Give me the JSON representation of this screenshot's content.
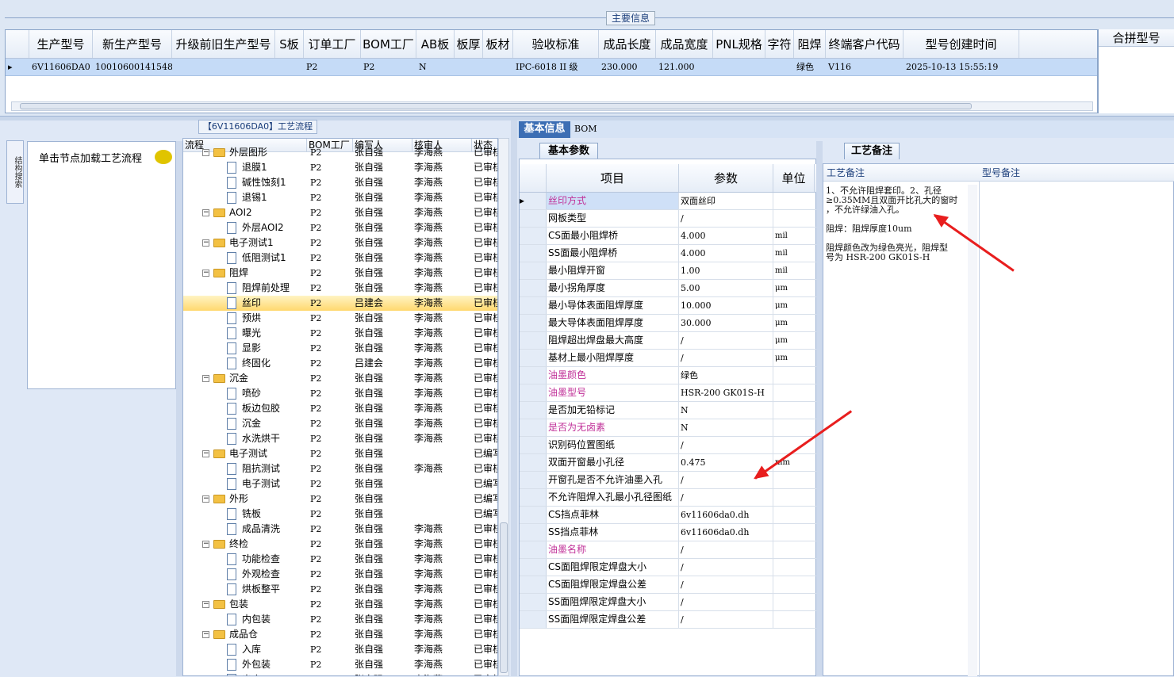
{
  "top": {
    "section_title": "主要信息",
    "columns": [
      "",
      "生产型号",
      "新生产型号",
      "升级前旧生产型号",
      "S板",
      "订单工厂",
      "BOM工厂",
      "AB板",
      "板厚",
      "板材",
      "验收标准",
      "成品长度",
      "成品宽度",
      "PNL规格",
      "字符",
      "阻焊",
      "终端客户代码",
      "型号创建时间"
    ],
    "row": [
      "▸",
      "6V11606DA0",
      "10010600141548",
      "",
      "",
      "P2",
      "P2",
      "N",
      "",
      "",
      "IPC-6018 II 级",
      "230.000",
      "121.000",
      "",
      "",
      "绿色",
      "V116",
      "2025-10-13 15:55:19"
    ],
    "merge_header": "合拼型号"
  },
  "left": {
    "side_tab": "结构搜索",
    "prompt": "单击节点加载工艺流程"
  },
  "tree": {
    "title": "【6V11606DA0】工艺流程",
    "columns": [
      "流程",
      "BOM工厂",
      "编写人",
      "核审人",
      "状态"
    ],
    "rows": [
      {
        "level": 1,
        "type": "folder",
        "name": "外层图形",
        "bom": "P2",
        "writer": "张自强",
        "checker": "李海燕",
        "status": "已审核"
      },
      {
        "level": 2,
        "type": "doc",
        "name": "退膜1",
        "bom": "P2",
        "writer": "张自强",
        "checker": "李海燕",
        "status": "已审核"
      },
      {
        "level": 2,
        "type": "doc",
        "name": "碱性蚀刻1",
        "bom": "P2",
        "writer": "张自强",
        "checker": "李海燕",
        "status": "已审核"
      },
      {
        "level": 2,
        "type": "doc",
        "name": "退锡1",
        "bom": "P2",
        "writer": "张自强",
        "checker": "李海燕",
        "status": "已审核"
      },
      {
        "level": 1,
        "type": "folder",
        "name": "AOI2",
        "bom": "P2",
        "writer": "张自强",
        "checker": "李海燕",
        "status": "已审核"
      },
      {
        "level": 2,
        "type": "doc",
        "name": "外层AOI2",
        "bom": "P2",
        "writer": "张自强",
        "checker": "李海燕",
        "status": "已审核"
      },
      {
        "level": 1,
        "type": "folder",
        "name": "电子测试1",
        "bom": "P2",
        "writer": "张自强",
        "checker": "李海燕",
        "status": "已审核"
      },
      {
        "level": 2,
        "type": "doc",
        "name": "低阻测试1",
        "bom": "P2",
        "writer": "张自强",
        "checker": "李海燕",
        "status": "已审核"
      },
      {
        "level": 1,
        "type": "folder",
        "name": "阻焊",
        "bom": "P2",
        "writer": "张自强",
        "checker": "李海燕",
        "status": "已审核"
      },
      {
        "level": 2,
        "type": "doc",
        "name": "阻焊前处理",
        "bom": "P2",
        "writer": "张自强",
        "checker": "李海燕",
        "status": "已审核"
      },
      {
        "level": 2,
        "type": "doc",
        "name": "丝印",
        "bom": "P2",
        "writer": "吕建会",
        "checker": "李海燕",
        "status": "已审核",
        "selected": true
      },
      {
        "level": 2,
        "type": "doc",
        "name": "预烘",
        "bom": "P2",
        "writer": "张自强",
        "checker": "李海燕",
        "status": "已审核"
      },
      {
        "level": 2,
        "type": "doc",
        "name": "曝光",
        "bom": "P2",
        "writer": "张自强",
        "checker": "李海燕",
        "status": "已审核"
      },
      {
        "level": 2,
        "type": "doc",
        "name": "显影",
        "bom": "P2",
        "writer": "张自强",
        "checker": "李海燕",
        "status": "已审核"
      },
      {
        "level": 2,
        "type": "doc",
        "name": "终固化",
        "bom": "P2",
        "writer": "吕建会",
        "checker": "李海燕",
        "status": "已审核"
      },
      {
        "level": 1,
        "type": "folder",
        "name": "沉金",
        "bom": "P2",
        "writer": "张自强",
        "checker": "李海燕",
        "status": "已审核"
      },
      {
        "level": 2,
        "type": "doc",
        "name": "喷砂",
        "bom": "P2",
        "writer": "张自强",
        "checker": "李海燕",
        "status": "已审核"
      },
      {
        "level": 2,
        "type": "doc",
        "name": "板边包胶",
        "bom": "P2",
        "writer": "张自强",
        "checker": "李海燕",
        "status": "已审核"
      },
      {
        "level": 2,
        "type": "doc",
        "name": "沉金",
        "bom": "P2",
        "writer": "张自强",
        "checker": "李海燕",
        "status": "已审核"
      },
      {
        "level": 2,
        "type": "doc",
        "name": "水洗烘干",
        "bom": "P2",
        "writer": "张自强",
        "checker": "李海燕",
        "status": "已审核"
      },
      {
        "level": 1,
        "type": "folder",
        "name": "电子测试",
        "bom": "P2",
        "writer": "张自强",
        "checker": "",
        "status": "已编写"
      },
      {
        "level": 2,
        "type": "doc",
        "name": "阻抗测试",
        "bom": "P2",
        "writer": "张自强",
        "checker": "李海燕",
        "status": "已审核"
      },
      {
        "level": 2,
        "type": "doc",
        "name": "电子测试",
        "bom": "P2",
        "writer": "张自强",
        "checker": "",
        "status": "已编写"
      },
      {
        "level": 1,
        "type": "folder",
        "name": "外形",
        "bom": "P2",
        "writer": "张自强",
        "checker": "",
        "status": "已编写"
      },
      {
        "level": 2,
        "type": "doc",
        "name": "铣板",
        "bom": "P2",
        "writer": "张自强",
        "checker": "",
        "status": "已编写"
      },
      {
        "level": 2,
        "type": "doc",
        "name": "成品清洗",
        "bom": "P2",
        "writer": "张自强",
        "checker": "李海燕",
        "status": "已审核"
      },
      {
        "level": 1,
        "type": "folder",
        "name": "终检",
        "bom": "P2",
        "writer": "张自强",
        "checker": "李海燕",
        "status": "已审核"
      },
      {
        "level": 2,
        "type": "doc",
        "name": "功能检查",
        "bom": "P2",
        "writer": "张自强",
        "checker": "李海燕",
        "status": "已审核"
      },
      {
        "level": 2,
        "type": "doc",
        "name": "外观检查",
        "bom": "P2",
        "writer": "张自强",
        "checker": "李海燕",
        "status": "已审核"
      },
      {
        "level": 2,
        "type": "doc",
        "name": "烘板整平",
        "bom": "P2",
        "writer": "张自强",
        "checker": "李海燕",
        "status": "已审核"
      },
      {
        "level": 1,
        "type": "folder",
        "name": "包装",
        "bom": "P2",
        "writer": "张自强",
        "checker": "李海燕",
        "status": "已审核"
      },
      {
        "level": 2,
        "type": "doc",
        "name": "内包装",
        "bom": "P2",
        "writer": "张自强",
        "checker": "李海燕",
        "status": "已审核"
      },
      {
        "level": 1,
        "type": "folder",
        "name": "成品仓",
        "bom": "P2",
        "writer": "张自强",
        "checker": "李海燕",
        "status": "已审核"
      },
      {
        "level": 2,
        "type": "doc",
        "name": "入库",
        "bom": "P2",
        "writer": "张自强",
        "checker": "李海燕",
        "status": "已审核"
      },
      {
        "level": 2,
        "type": "doc",
        "name": "外包装",
        "bom": "P2",
        "writer": "张自强",
        "checker": "李海燕",
        "status": "已审核"
      },
      {
        "level": 2,
        "type": "doc",
        "name": "出库",
        "bom": "P2",
        "writer": "张自强",
        "checker": "李海燕",
        "status": "已审核"
      }
    ]
  },
  "right": {
    "tabs": [
      "基本信息",
      "BOM"
    ],
    "subtab": "基本参数",
    "columns": [
      "",
      "项目",
      "参数",
      "单位"
    ],
    "params": [
      {
        "k": "丝印方式",
        "v": "双面丝印",
        "u": "",
        "pink": true,
        "selected": true
      },
      {
        "k": "网板类型",
        "v": "/",
        "u": ""
      },
      {
        "k": "CS面最小阻焊桥",
        "v": "4.000",
        "u": "mil"
      },
      {
        "k": "SS面最小阻焊桥",
        "v": "4.000",
        "u": "mil"
      },
      {
        "k": "最小阻焊开窗",
        "v": "1.00",
        "u": "mil"
      },
      {
        "k": "最小拐角厚度",
        "v": "5.00",
        "u": "μm"
      },
      {
        "k": "最小导体表面阻焊厚度",
        "v": "10.000",
        "u": "μm"
      },
      {
        "k": "最大导体表面阻焊厚度",
        "v": "30.000",
        "u": "μm"
      },
      {
        "k": "阻焊超出焊盘最大高度",
        "v": "/",
        "u": "μm"
      },
      {
        "k": "基材上最小阻焊厚度",
        "v": "/",
        "u": "μm"
      },
      {
        "k": "油墨颜色",
        "v": "绿色",
        "u": "",
        "pink": true
      },
      {
        "k": "油墨型号",
        "v": "HSR-200 GK01S-H",
        "u": "",
        "pink": true
      },
      {
        "k": "是否加无铅标记",
        "v": "N",
        "u": ""
      },
      {
        "k": "是否为无卤素",
        "v": "N",
        "u": "",
        "pink": true
      },
      {
        "k": "识别码位置图纸",
        "v": "/",
        "u": ""
      },
      {
        "k": "双面开窗最小孔径",
        "v": "0.475",
        "u": "mm"
      },
      {
        "k": "开窗孔是否不允许油墨入孔",
        "v": "/",
        "u": ""
      },
      {
        "k": "不允许阻焊入孔最小孔径图纸",
        "v": "/",
        "u": ""
      },
      {
        "k": "CS挡点菲林",
        "v": "6v11606da0.dh",
        "u": ""
      },
      {
        "k": "SS挡点菲林",
        "v": "6v11606da0.dh",
        "u": ""
      },
      {
        "k": "油墨名称",
        "v": "/",
        "u": "",
        "pink": true
      },
      {
        "k": "CS面阻焊限定焊盘大小",
        "v": "/",
        "u": ""
      },
      {
        "k": "CS面阻焊限定焊盘公差",
        "v": "/",
        "u": ""
      },
      {
        "k": "SS面阻焊限定焊盘大小",
        "v": "/",
        "u": ""
      },
      {
        "k": "SS面阻焊限定焊盘公差",
        "v": "/",
        "u": ""
      }
    ]
  },
  "craft": {
    "tab": "工艺备注",
    "col1": "工艺备注",
    "col2": "型号备注",
    "note": "1、不允许阻焊套印。2、孔径\n≥0.35MM且双面开比孔大的窗时\n，不允许绿油入孔。\n\n阻焊：阻焊厚度10um\n\n阻焊颜色改为绿色亮光，阻焊型\n号为 HSR-200 GK01S-H"
  },
  "colors": {
    "accent": "#3c6eb4",
    "highlight": "#c5dbf7",
    "pink_label": "#c03098",
    "arrow": "#e81e1e"
  }
}
